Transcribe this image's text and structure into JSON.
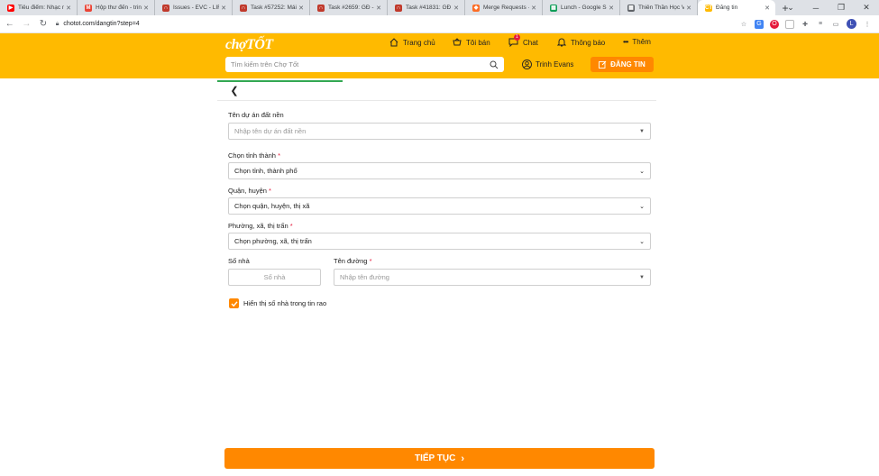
{
  "browser": {
    "tabs": [
      {
        "title": "Tiêu điểm: Nhạc nh",
        "favicon_color": "#ff0000",
        "favicon": "▶"
      },
      {
        "title": "Hộp thư đến - trinh",
        "favicon_color": "#ea4335",
        "favicon": "M"
      },
      {
        "title": "Issues - EVC - LIFET",
        "favicon_color": "#c0392b",
        "favicon": "∩"
      },
      {
        "title": "Task #57252: Mái b",
        "favicon_color": "#c0392b",
        "favicon": "∩"
      },
      {
        "title": "Task #2659: GĐ - H",
        "favicon_color": "#c0392b",
        "favicon": "∩"
      },
      {
        "title": "Task #41831: GĐ - I",
        "favicon_color": "#c0392b",
        "favicon": "∩"
      },
      {
        "title": "Merge Requests · E",
        "favicon_color": "#fc6d26",
        "favicon": "◆"
      },
      {
        "title": "Lunch - Google She",
        "favicon_color": "#0f9d58",
        "favicon": "▦"
      },
      {
        "title": "Thiên Thần Học Vi",
        "favicon_color": "#5f6368",
        "favicon": "▦"
      },
      {
        "title": "Đăng tin",
        "favicon_color": "#ffba00",
        "favicon": "CT",
        "active": true
      }
    ],
    "new_tab": "+",
    "url": "chotot.com/dangtin?step=4",
    "profile_initial": "L"
  },
  "header": {
    "logo": "chợTỐT",
    "nav": {
      "home": "Trang chủ",
      "mine": "Tôi bán",
      "chat": "Chat",
      "chat_badge": "1",
      "notif": "Thông báo",
      "more": "Thêm"
    },
    "search_placeholder": "Tìm kiếm trên Chợ Tốt",
    "user_name": "Trinh Evans",
    "post_button": "ĐĂNG TIN"
  },
  "progress": {
    "fraction": 0.285
  },
  "form": {
    "project": {
      "label": "Tên dự án đất nền",
      "placeholder": "Nhập tên dự án đất nền"
    },
    "province": {
      "label": "Chọn tỉnh thành",
      "required": "*",
      "value": "Chọn tỉnh, thành phố"
    },
    "district": {
      "label": "Quận, huyện",
      "required": "*",
      "value": "Chọn quận, huyện, thị xã"
    },
    "ward": {
      "label": "Phường, xã, thị trấn",
      "required": "*",
      "value": "Chọn phường, xã, thị trấn"
    },
    "house_no": {
      "label": "Số nhà",
      "placeholder": "Số nhà"
    },
    "street": {
      "label": "Tên đường",
      "required": "*",
      "placeholder": "Nhập tên đường"
    },
    "show_house_no": {
      "label": "Hiển thị số nhà trong tin rao",
      "checked": true
    }
  },
  "next_button": "TIẾP TỤC"
}
